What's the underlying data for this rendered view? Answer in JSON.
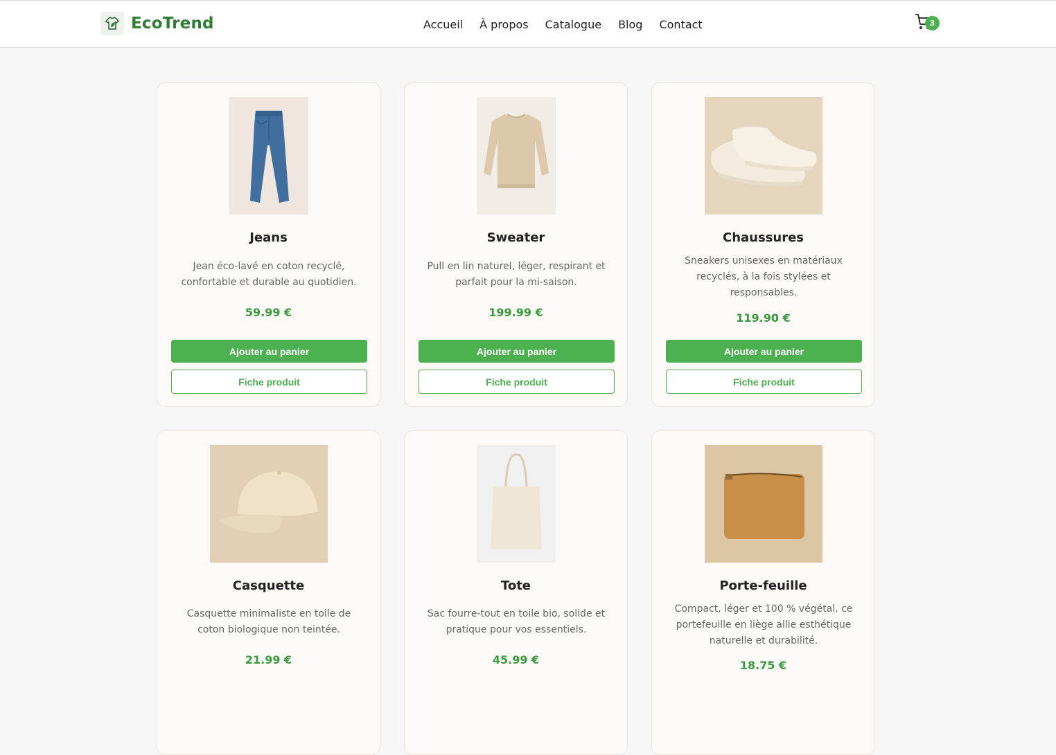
{
  "header": {
    "brand": "EcoTrend",
    "nav": [
      "Accueil",
      "À propos",
      "Catalogue",
      "Blog",
      "Contact"
    ],
    "cart_count": "3"
  },
  "products": [
    {
      "name": "Jeans",
      "desc_lines": [
        "Jean éco-lavé en coton recyclé,",
        "confortable et durable au quotidien."
      ],
      "price": "59.99 €",
      "add": "Ajouter au panier",
      "details": "Fiche produit",
      "image": "jeans"
    },
    {
      "name": "Sweater",
      "desc_lines": [
        "Pull en lin naturel, léger, respirant et",
        "parfait pour la mi-saison."
      ],
      "price": "199.99 €",
      "add": "Ajouter au panier",
      "details": "Fiche produit",
      "image": "sweater"
    },
    {
      "name": "Chaussures",
      "desc_lines": [
        "Sneakers unisexes en matériaux",
        "recyclés, à la fois stylées et",
        "responsables."
      ],
      "price": "119.90 €",
      "add": "Ajouter au panier",
      "details": "Fiche produit",
      "image": "sneakers"
    },
    {
      "name": "Casquette",
      "desc_lines": [
        "Casquette minimaliste en toile de",
        "coton biologique non teintée."
      ],
      "price": "21.99 €",
      "image": "cap"
    },
    {
      "name": "Tote",
      "desc_lines": [
        "Sac fourre-tout en toile bio, solide et",
        "pratique pour vos essentiels."
      ],
      "price": "45.99 €",
      "image": "tote bag"
    },
    {
      "name": "Porte-feuille",
      "desc_lines": [
        "Compact, léger et 100 % végétal, ce",
        "portefeuille en liège allie esthétique",
        "naturelle et durabilité."
      ],
      "price": "18.75 €",
      "image": "cork wallet"
    }
  ],
  "colors": {
    "brand": "#2f7d32",
    "accent": "#4caf50",
    "price": "#3a9a3e"
  }
}
